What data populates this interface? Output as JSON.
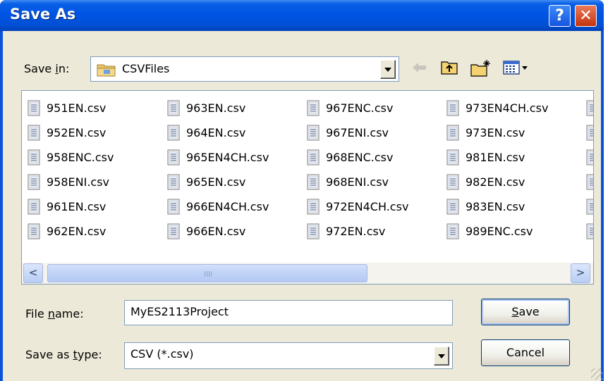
{
  "window": {
    "title": "Save As"
  },
  "titlebar": {
    "help_glyph": "?",
    "close_glyph": "✕"
  },
  "save_in": {
    "label_prefix": "Save ",
    "label_underlined": "i",
    "label_suffix": "n:",
    "value": "CSVFiles",
    "icon": "folder-icon"
  },
  "toolbar": {
    "icons": [
      "back-arrow-icon",
      "up-folder-icon",
      "new-folder-icon",
      "view-menu-icon"
    ]
  },
  "files": {
    "items": [
      "951EN.csv",
      "952EN.csv",
      "958ENC.csv",
      "958ENI.csv",
      "961EN.csv",
      "962EN.csv",
      "963EN.csv",
      "964EN.csv",
      "965EN4CH.csv",
      "965EN.csv",
      "966EN4CH.csv",
      "966EN.csv",
      "967ENC.csv",
      "967ENI.csv",
      "968ENC.csv",
      "968ENI.csv",
      "972EN4CH.csv",
      "972EN.csv",
      "973EN4CH.csv",
      "973EN.csv",
      "981EN.csv",
      "982EN.csv",
      "983EN.csv",
      "989ENC.csv"
    ],
    "partial_column_visible": true
  },
  "scrollbar": {
    "left_arrow": "<",
    "right_arrow": ">"
  },
  "file_name": {
    "label_prefix": "File ",
    "label_underlined": "n",
    "label_suffix": "ame:",
    "value": "MyES2113Project"
  },
  "save_as_type": {
    "label_prefix": "Save as ",
    "label_underlined": "t",
    "label_suffix": "ype:",
    "value": "CSV (*.csv)"
  },
  "buttons": {
    "save_underlined": "S",
    "save_rest": "ave",
    "cancel": "Cancel"
  },
  "colors": {
    "titlebar": "#0054e3",
    "client": "#ece9d8",
    "close_button": "#c6330e",
    "border": "#7f9db9"
  }
}
